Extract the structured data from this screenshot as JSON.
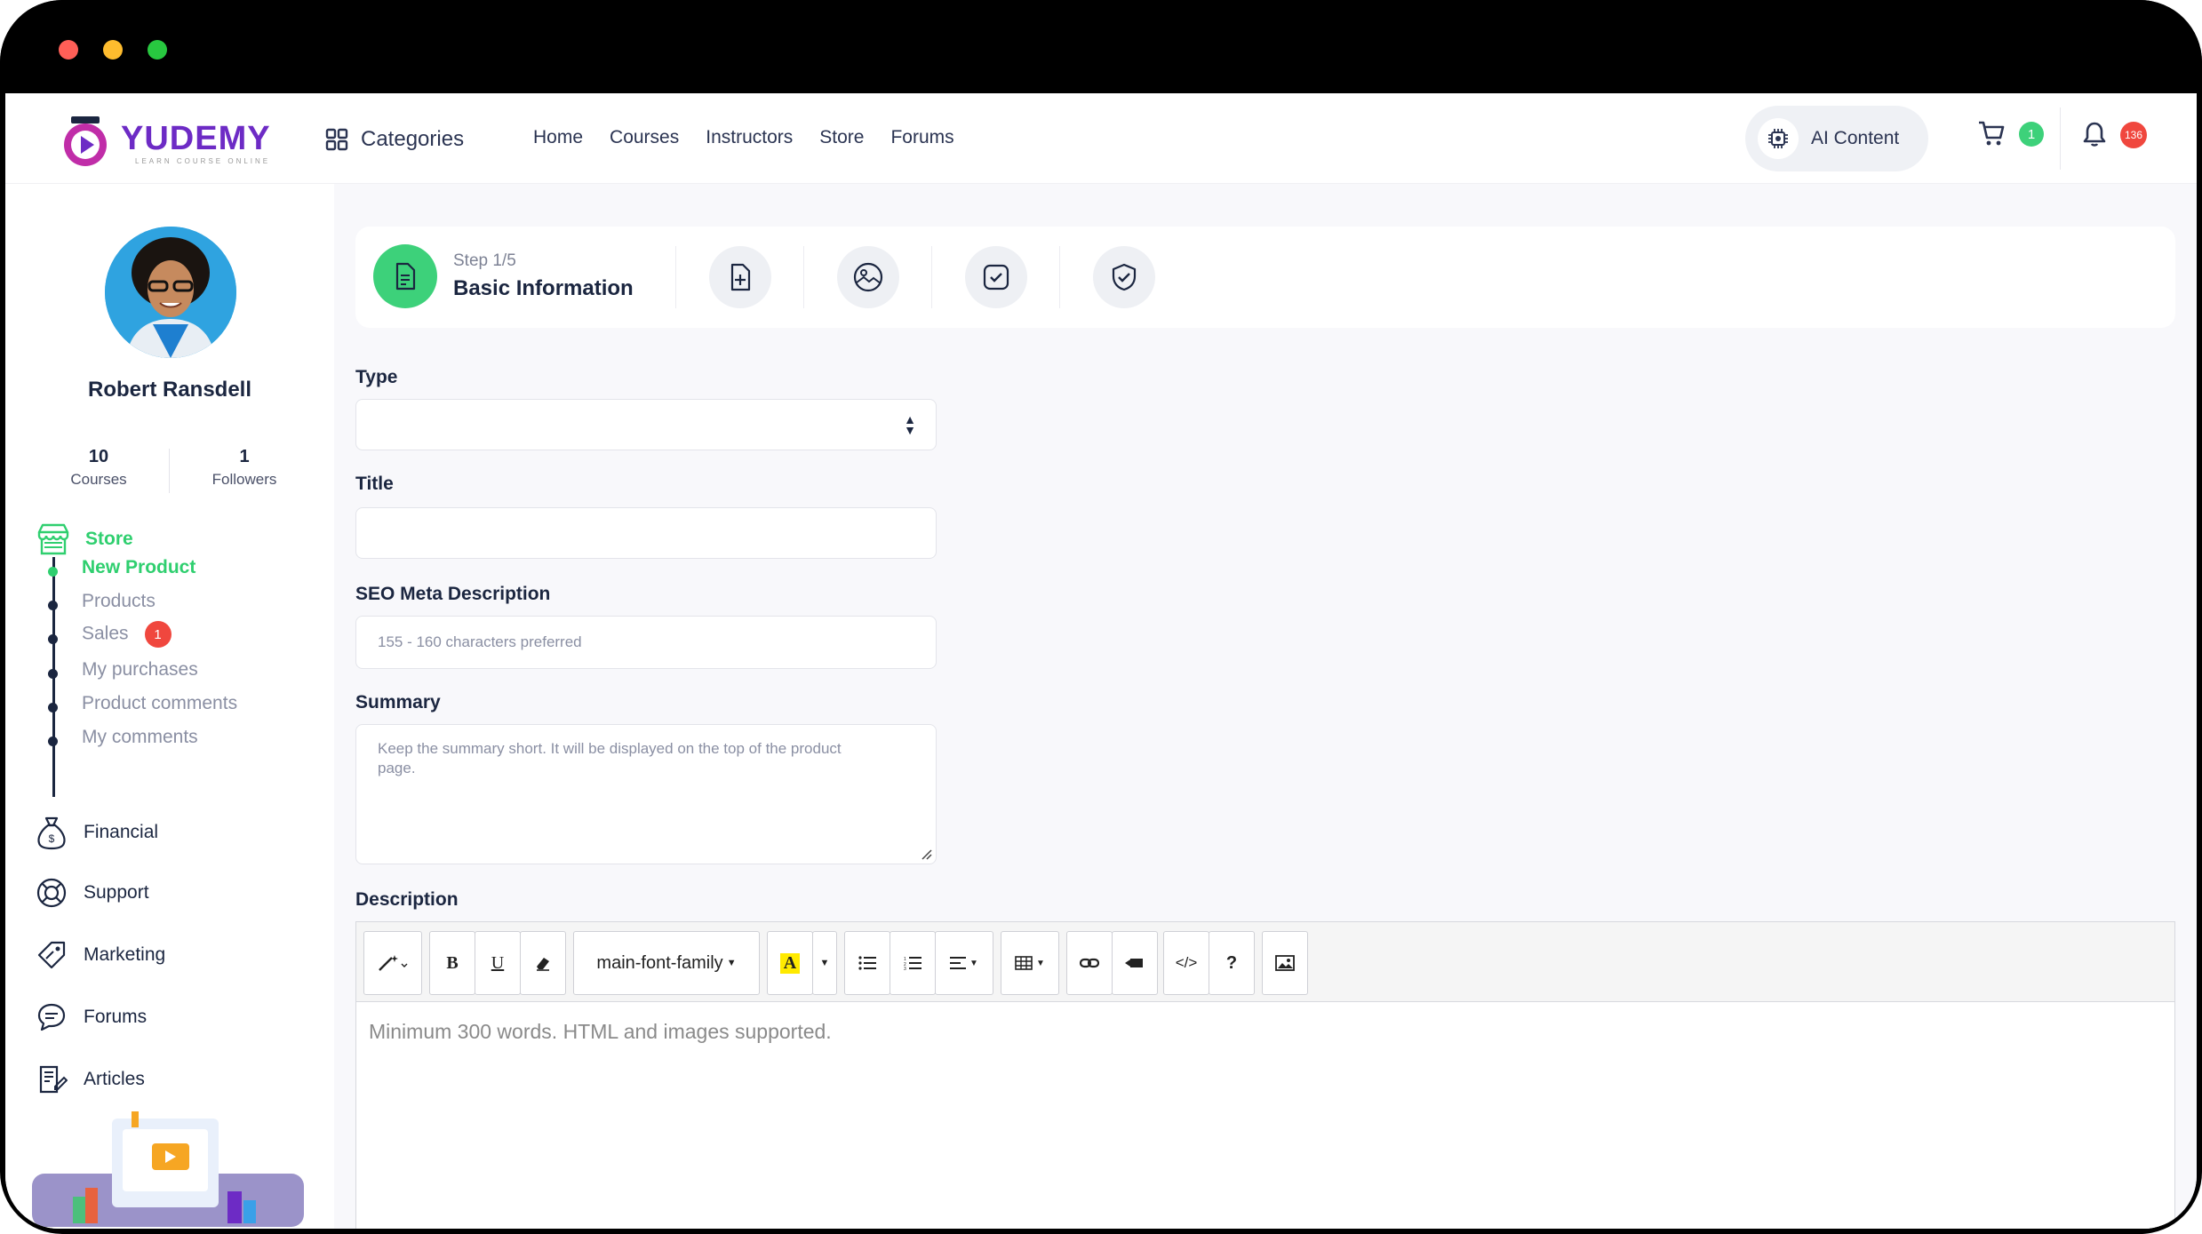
{
  "colors": {
    "accent_green": "#3dd17a",
    "badge_red": "#f0473e",
    "brand_purple": "#6d2bc5",
    "dark_text": "#1b2640"
  },
  "navbar": {
    "logo_text": "YUDEMY",
    "logo_tagline": "LEARN COURSE ONLINE",
    "categories_label": "Categories",
    "links": [
      "Home",
      "Courses",
      "Instructors",
      "Store",
      "Forums"
    ],
    "ai_content_label": "AI Content",
    "cart_count": "1",
    "notification_count": "136"
  },
  "sidebar": {
    "user_name": "Robert Ransdell",
    "stats": {
      "courses_count": "10",
      "courses_label": "Courses",
      "followers_count": "1",
      "followers_label": "Followers"
    },
    "store_label": "Store",
    "store_items": [
      {
        "label": "New Product",
        "active": true
      },
      {
        "label": "Products",
        "active": false
      },
      {
        "label": "Sales",
        "active": false,
        "badge": "1"
      },
      {
        "label": "My purchases",
        "active": false
      },
      {
        "label": "Product comments",
        "active": false
      },
      {
        "label": "My comments",
        "active": false
      }
    ],
    "menu": [
      "Financial",
      "Support",
      "Marketing",
      "Forums",
      "Articles"
    ]
  },
  "stepper": {
    "step_small": "Step 1/5",
    "step_title": "Basic Information"
  },
  "form": {
    "type_label": "Type",
    "title_label": "Title",
    "seo_label": "SEO Meta Description",
    "seo_placeholder": "155 - 160 characters preferred",
    "summary_label": "Summary",
    "summary_placeholder": "Keep the summary short. It will be displayed on the top of the product page.",
    "description_label": "Description",
    "description_placeholder": "Minimum 300 words. HTML and images supported."
  },
  "editor_toolbar": {
    "font_family": "main-font-family",
    "bold": "B",
    "underline": "U",
    "highlight": "A",
    "help": "?",
    "code": "</>"
  }
}
